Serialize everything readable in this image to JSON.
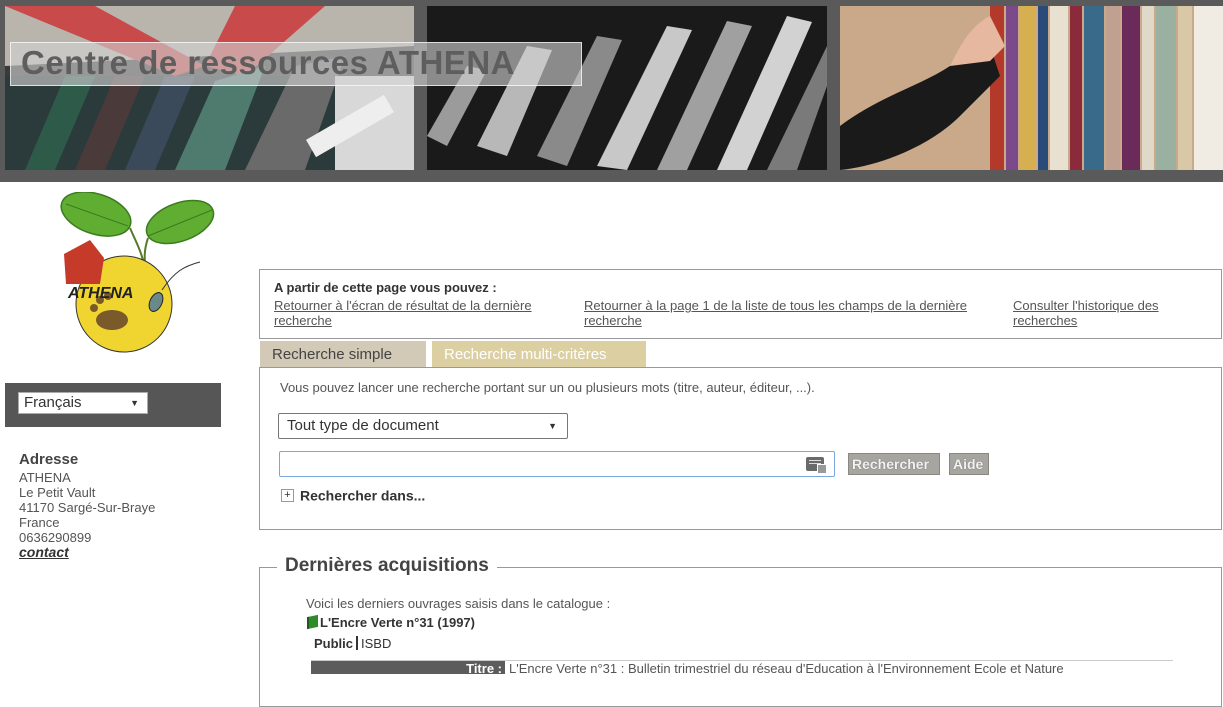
{
  "header": {
    "site_title": "Centre de ressources ATHENA"
  },
  "logo": {
    "text": "ATHENA"
  },
  "language": {
    "selected": "Français"
  },
  "address": {
    "heading": "Adresse",
    "lines": [
      "ATHENA",
      "Le Petit Vault",
      "41170 Sargé-Sur-Braye",
      "France",
      "0636290899"
    ],
    "contact_label": "contact"
  },
  "navigation": {
    "intro": "A partir de cette page vous pouvez :",
    "links": [
      "Retourner à l'écran de résultat de la dernière recherche",
      "Retourner à la page 1 de la liste de tous les champs de la dernière recherche",
      "Consulter l'historique des recherches"
    ]
  },
  "tabs": [
    {
      "label": "Recherche simple",
      "active": true
    },
    {
      "label": "Recherche multi-critères",
      "active": false
    }
  ],
  "search": {
    "hint": "Vous pouvez lancer une recherche portant sur un ou plusieurs mots (titre, auteur, éditeur, ...).",
    "doc_type_selected": "Tout type de document",
    "query_value": "",
    "search_button": "Rechercher",
    "help_button": "Aide",
    "refine_label": "Rechercher dans..."
  },
  "acquisitions": {
    "title": "Dernières acquisitions",
    "intro": "Voici les derniers ouvrages saisis dans le catalogue :",
    "item_title": "L'Encre Verte n°31 (1997)",
    "view_tabs": [
      "Public",
      "ISBD"
    ],
    "record_field_label": "Titre :",
    "record_field_value": "L'Encre Verte n°31 : Bulletin trimestriel du réseau d'Education à l'Environnement Ecole et Nature"
  },
  "colors": {
    "banner_bg": "#5a5a5a",
    "tab_active": "#d2c9b7",
    "tab_inactive": "#dccfa2",
    "button_gray": "#a7a59f",
    "logo_yellow": "#f0d531",
    "logo_leaf_green": "#5fae32",
    "logo_house_red": "#c63a2a"
  }
}
